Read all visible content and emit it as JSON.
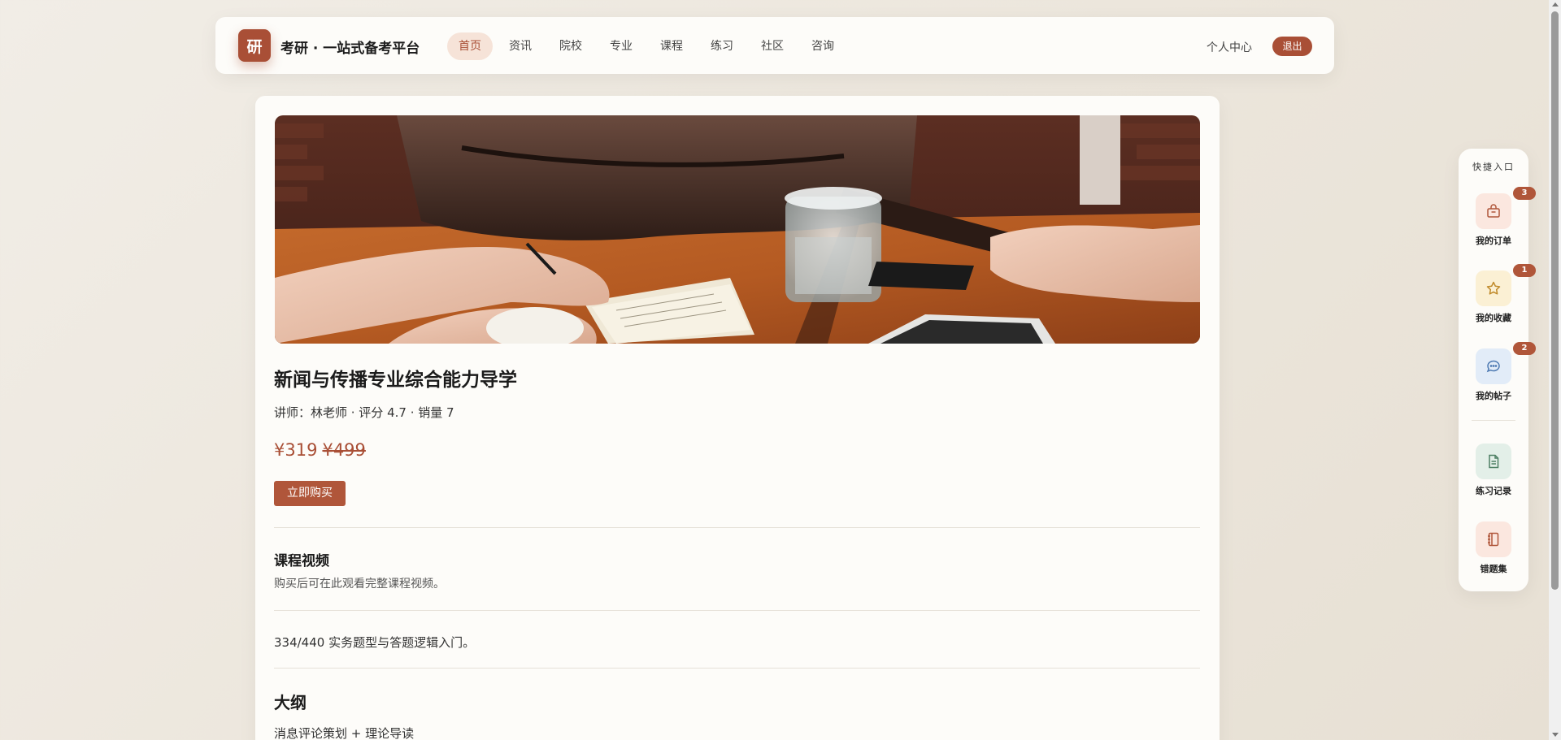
{
  "header": {
    "logo_char": "研",
    "brand": "考研 · 一站式备考平台",
    "nav": [
      {
        "label": "首页",
        "active": true
      },
      {
        "label": "资讯",
        "active": false
      },
      {
        "label": "院校",
        "active": false
      },
      {
        "label": "专业",
        "active": false
      },
      {
        "label": "课程",
        "active": false
      },
      {
        "label": "练习",
        "active": false
      },
      {
        "label": "社区",
        "active": false
      },
      {
        "label": "咨询",
        "active": false
      }
    ],
    "user_center": "个人中心",
    "logout": "退出"
  },
  "course": {
    "title": "新闻与传播专业综合能力导学",
    "meta": "讲师：林老师 · 评分 4.7 · 销量 7",
    "price": "¥319",
    "original_price": "¥499",
    "buy_label": "立即购买",
    "video_title": "课程视频",
    "video_hint": "购买后可在此观看完整课程视频。",
    "description": "334/440 实务题型与答题逻辑入门。",
    "outline_title": "大纲",
    "outline_text": "消息评论策划 + 理论导读"
  },
  "quick_panel": {
    "title": "快捷入口",
    "items": [
      {
        "label": "我的订单",
        "badge": "3",
        "icon": "bag-icon",
        "bg": "#fbe7df",
        "color": "#b0563a"
      },
      {
        "label": "我的收藏",
        "badge": "1",
        "icon": "star-icon",
        "bg": "#fbf0d4",
        "color": "#c08a2a"
      },
      {
        "label": "我的帖子",
        "badge": "2",
        "icon": "chat-icon",
        "bg": "#e2ecf8",
        "color": "#4f7bb3"
      },
      {
        "label": "练习记录",
        "badge": "",
        "icon": "document-icon",
        "bg": "#e3efe8",
        "color": "#4d7f63"
      },
      {
        "label": "错题集",
        "badge": "",
        "icon": "notebook-icon",
        "bg": "#fbe7df",
        "color": "#b0563a"
      }
    ]
  },
  "colors": {
    "accent": "#a94f36",
    "background": "#ece6dc",
    "card": "#fdfcf9"
  }
}
